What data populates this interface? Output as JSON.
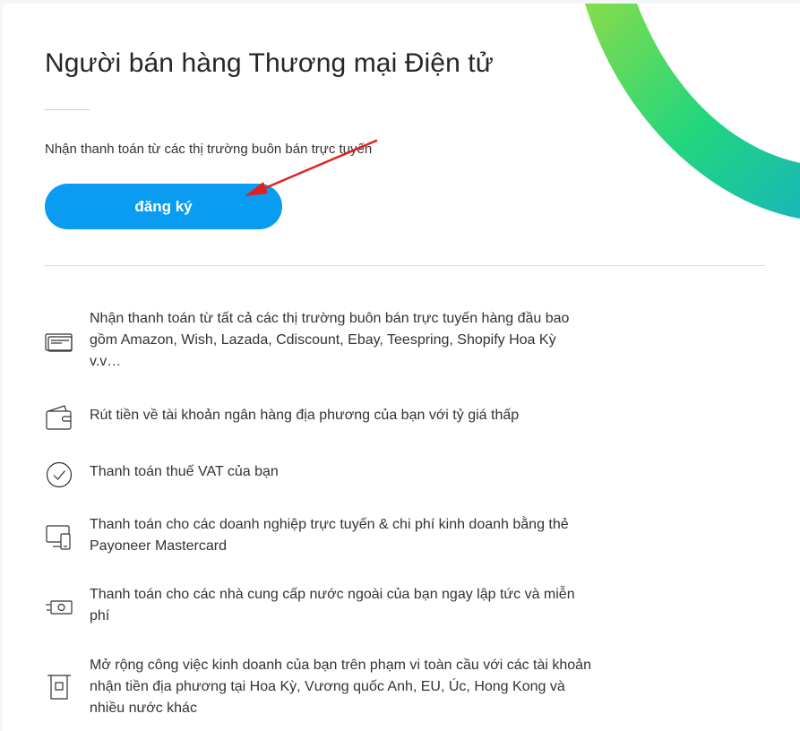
{
  "header": {
    "title": "Người bán hàng Thương mại Điện tử",
    "subtitle": "Nhận thanh toán từ các thị trường buôn bán trực tuyến",
    "signup_label": "đăng ký"
  },
  "features": [
    {
      "icon": "card-stack-icon",
      "text": "Nhận thanh toán từ tất cả các thị trường buôn bán trực tuyến hàng đầu bao gồm Amazon, Wish, Lazada, Cdiscount, Ebay, Teespring, Shopify Hoa Kỳ v.v…"
    },
    {
      "icon": "wallet-icon",
      "text": "Rút tiền về tài khoản ngân hàng địa phương của bạn với tỷ giá thấp"
    },
    {
      "icon": "check-circle-icon",
      "text": "Thanh toán thuế VAT của bạn"
    },
    {
      "icon": "devices-icon",
      "text": "Thanh toán cho các doanh nghiệp trực tuyến & chi phí kinh doanh bằng thẻ Payoneer Mastercard"
    },
    {
      "icon": "fast-cash-icon",
      "text": "Thanh toán cho các nhà cung cấp nước ngoài của bạn ngay lập tức và miễn phí"
    },
    {
      "icon": "bank-receipt-icon",
      "text": "Mở rộng công việc kinh doanh của bạn trên phạm vi toàn cầu với các tài khoản nhận tiền địa phương tại Hoa Kỳ, Vương quốc Anh, EU, Úc, Hong Kong và nhiều nước khác"
    }
  ],
  "colors": {
    "accent": "#0a9cf0",
    "annotation_arrow": "#e02020",
    "arc_start": "#7ed957",
    "arc_mid": "#2ad67a",
    "arc_end": "#1cc0b0"
  }
}
